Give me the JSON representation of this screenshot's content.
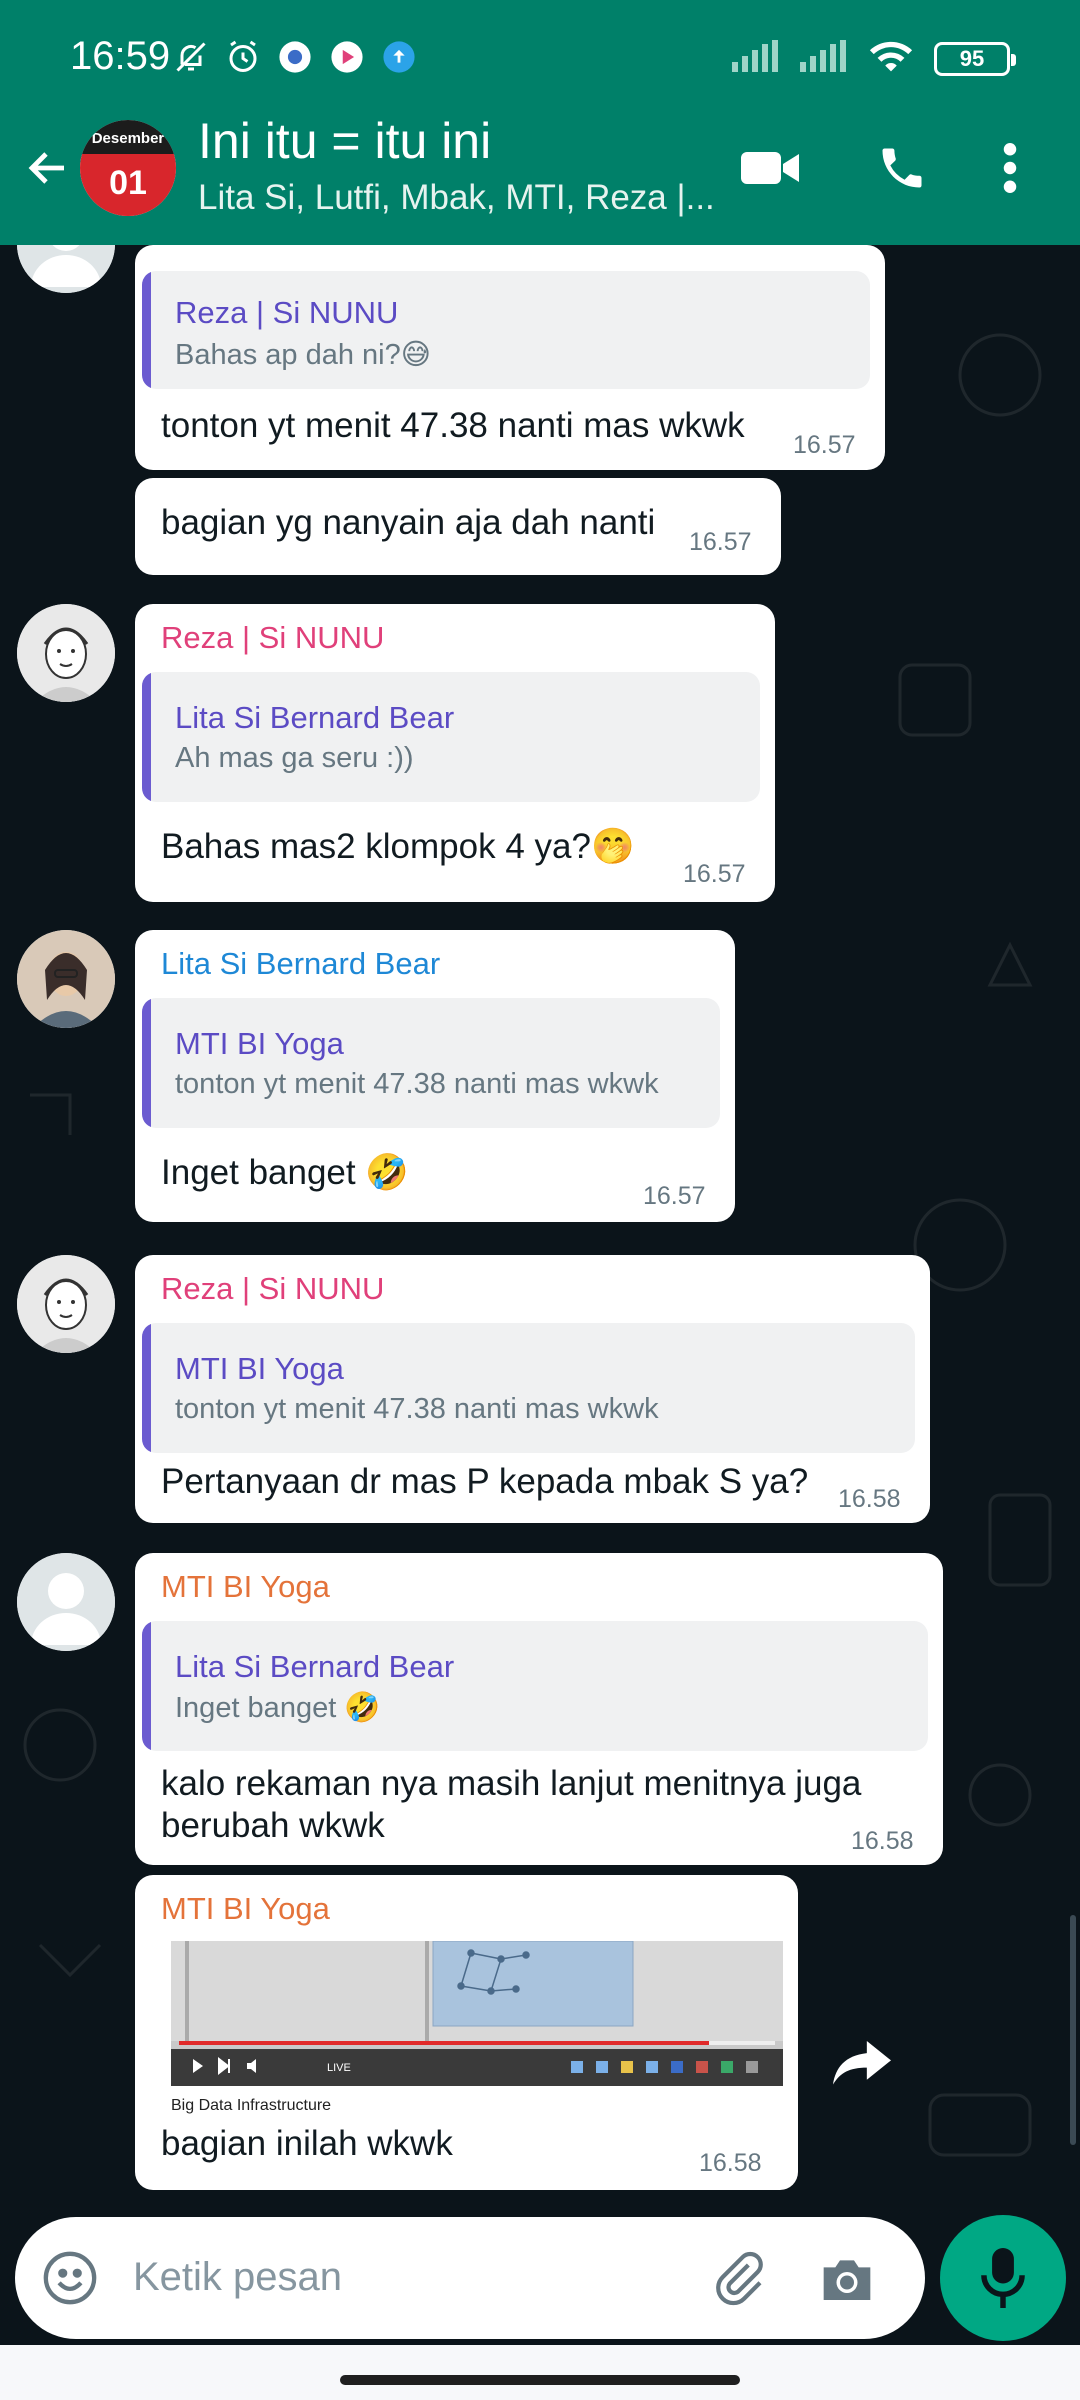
{
  "status_bar": {
    "time": "16:59",
    "battery": "95"
  },
  "header": {
    "avatar_month": "Desember",
    "avatar_day": "01",
    "title": "Ini itu = itu ini",
    "subtitle": "Lita Si, Lutfi, Mbak, MTI, Reza |..."
  },
  "messages": [
    {
      "quote": {
        "name": "Reza | Si NUNU",
        "text": "Bahas ap dah ni?😅"
      },
      "text": "tonton yt menit 47.38 nanti mas wkwk",
      "time": "16.57"
    },
    {
      "text": "bagian yg nanyain aja dah nanti",
      "time": "16.57"
    },
    {
      "sender": "Reza | Si NUNU",
      "quote": {
        "name": "Lita Si Bernard Bear",
        "text": "Ah mas ga seru :))"
      },
      "text": "Bahas mas2 klompok 4 ya?🤭",
      "time": "16.57"
    },
    {
      "sender": "Lita Si Bernard Bear",
      "quote": {
        "name": "MTI BI Yoga",
        "text": "tonton yt menit 47.38 nanti mas wkwk"
      },
      "text": "Inget banget 🤣",
      "time": "16.57"
    },
    {
      "sender": "Reza | Si NUNU",
      "quote": {
        "name": "MTI BI Yoga",
        "text": "tonton yt menit 47.38 nanti mas wkwk"
      },
      "text": "Pertanyaan dr mas P kepada mbak S ya?",
      "time": "16.58"
    },
    {
      "sender": "MTI BI Yoga",
      "quote": {
        "name": "Lita Si Bernard Bear",
        "text": "Inget banget 🤣"
      },
      "text_line1": "kalo rekaman nya masih lanjut menitnya juga",
      "text_line2": "berubah wkwk",
      "time": "16.58"
    },
    {
      "sender": "MTI BI Yoga",
      "image_caption": "Big Data Infrastructure",
      "image_live": "LIVE",
      "text": "bagian inilah wkwk",
      "time": "16.58"
    }
  ],
  "input": {
    "placeholder": "Ketik pesan"
  },
  "colors": {
    "header": "#008069",
    "sender_reza": "#e0407a",
    "sender_lita": "#1e88d6",
    "sender_mti": "#e4733a",
    "quote_accent": "#6b5bd0",
    "mic": "#00a884"
  }
}
